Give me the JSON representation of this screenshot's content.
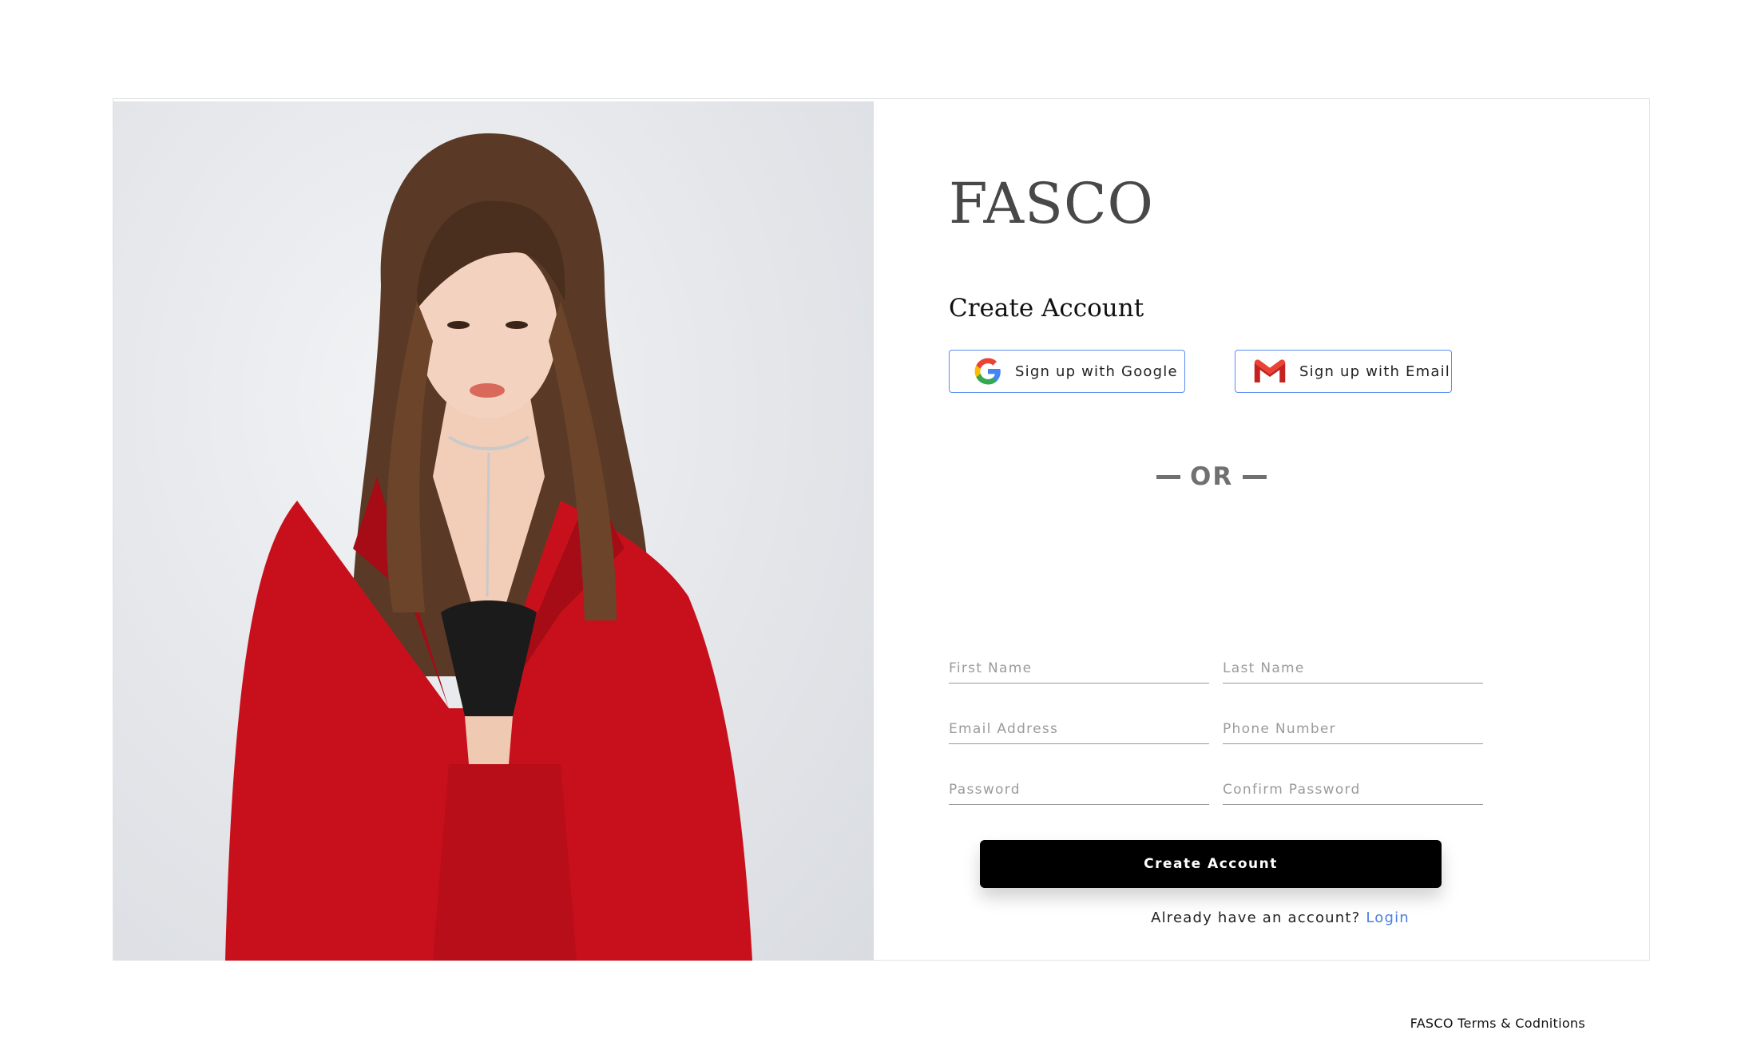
{
  "brand": {
    "name": "FASCO"
  },
  "form": {
    "heading": "Create Account",
    "google_label": "Sign up with Google",
    "email_label": "Sign up with Email",
    "or_text": "OR",
    "fields": {
      "first_name": "First Name",
      "last_name": "Last Name",
      "email": "Email Address",
      "phone": "Phone Number",
      "password": "Password",
      "confirm_password": "Confirm Password"
    },
    "submit_label": "Create Account",
    "login_prompt": "Already have an account?",
    "login_link": "Login"
  },
  "footer": {
    "terms": "FASCO Terms & Codnitions"
  },
  "colors": {
    "accent": "#4a7fe0",
    "button_bg": "#000000",
    "jacket": "#c8101c"
  },
  "icons": {
    "google": "google-logo-icon",
    "gmail": "gmail-logo-icon"
  }
}
